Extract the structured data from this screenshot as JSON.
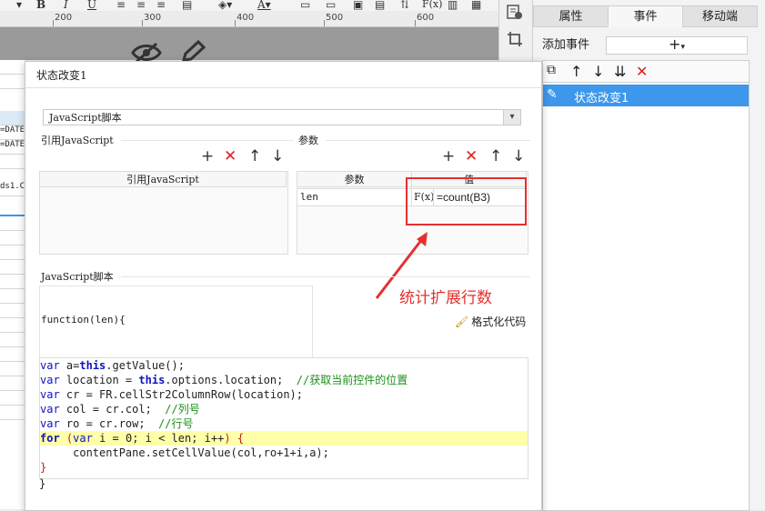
{
  "ruler": {
    "ticks": [
      "200",
      "300",
      "400",
      "500",
      "600"
    ]
  },
  "sheet_rows": [
    "=DATE",
    "=DATE",
    "",
    "ds1.C",
    "",
    "",
    "",
    "",
    "",
    "",
    "",
    "",
    "",
    "",
    "",
    "",
    "",
    "",
    "",
    "",
    "",
    ""
  ],
  "panel": {
    "tabs": [
      "属性",
      "事件",
      "移动端"
    ],
    "add_event_label": "添加事件",
    "add_icon": "+",
    "events": [
      {
        "label": "状态改变1"
      }
    ]
  },
  "dialog": {
    "title": "状态改变1",
    "type_select": "JavaScript脚本",
    "ref_js": {
      "title": "引用JavaScript",
      "column": "引用JavaScript"
    },
    "params": {
      "title": "参数",
      "col_param": "参数",
      "col_value": "值",
      "rows": [
        {
          "name": "len",
          "fx": "F(x)",
          "value": "=count(B3)"
        }
      ]
    },
    "annotation": "统计扩展行数",
    "script_title": "JavaScript脚本",
    "fn_signature": "function(len){",
    "format_button": "格式化代码",
    "code_close": "}"
  },
  "colors": {
    "accent": "#3d97ea",
    "annotation": "#e53030",
    "delete": "#e02020",
    "code_keyword": "#1010c0",
    "code_comment": "#1a8f1a",
    "code_highlight": "#ffffaa"
  },
  "icons": [
    "bold-icon",
    "underline-icon",
    "align-left-icon",
    "align-center-icon",
    "align-right-icon",
    "fill-color-icon",
    "font-color-icon",
    "border-icon",
    "insert-image-icon",
    "formula-icon",
    "chart-icon",
    "hide-icon",
    "edit-icon",
    "copy-icon",
    "arrow-up-icon",
    "arrow-down-icon",
    "sort-down-icon",
    "delete-icon",
    "pencil-icon",
    "format-brush-icon"
  ]
}
